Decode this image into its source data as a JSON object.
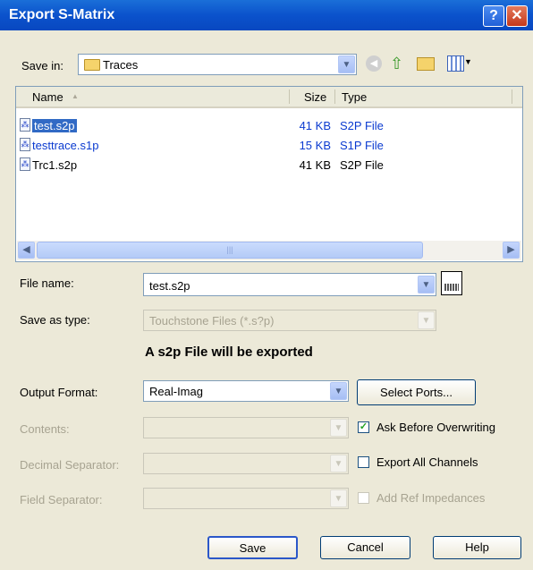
{
  "window": {
    "title": "Export S-Matrix"
  },
  "save_in": {
    "label": "Save in:",
    "folder": "Traces"
  },
  "list": {
    "columns": [
      "Name",
      "Size",
      "Type"
    ],
    "rows": [
      {
        "name": "test.s2p",
        "size": "41 KB",
        "type": "S2P File"
      },
      {
        "name": "testtrace.s1p",
        "size": "15 KB",
        "type": "S1P File"
      },
      {
        "name": "Trc1.s2p",
        "size": "41 KB",
        "type": "S2P File"
      }
    ]
  },
  "file_name": {
    "label": "File name:",
    "value": "test.s2p"
  },
  "save_type": {
    "label": "Save as type:",
    "value": "Touchstone Files (*.s?p)"
  },
  "export_note": "A s2p File will be exported",
  "output_format": {
    "label": "Output Format:",
    "value": "Real-Imag"
  },
  "select_ports_label": "Select Ports...",
  "contents_label": "Contents:",
  "decimal_label": "Decimal Separator:",
  "field_label": "Field Separator:",
  "options": {
    "ask_overwrite": {
      "label": "Ask Before Overwriting",
      "checked": true
    },
    "export_all": {
      "label": "Export All Channels",
      "checked": false
    },
    "add_ref": {
      "label": "Add Ref Impedances",
      "checked": false
    }
  },
  "buttons": {
    "save": "Save",
    "cancel": "Cancel",
    "help": "Help"
  }
}
